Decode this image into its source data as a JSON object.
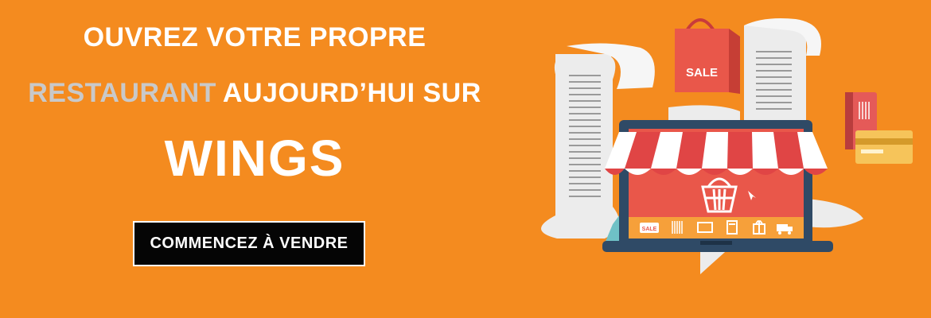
{
  "headline": {
    "line1": "OUVREZ VOTRE PROPRE",
    "line2_highlight": "RESTAURANT",
    "line2_rest": "AUJOURD’HUI SUR",
    "line3": "WINGS"
  },
  "cta": {
    "label": "COMMENCEZ À VENDRE"
  },
  "illustration": {
    "bag_label": "SALE",
    "tag_label": "SALE",
    "icons": [
      "basket-icon",
      "sale-tag-icon",
      "barcode-icon",
      "scanner-icon",
      "calculator-icon",
      "gift-icon",
      "truck-icon",
      "credit-card-icon",
      "shopping-bag-icon"
    ]
  },
  "colors": {
    "background": "#f48b1f",
    "headline_text": "#ffffff",
    "highlight_text": "#c9c9c9",
    "button_bg": "#050505",
    "awning_red": "#e04545",
    "screen_red": "#e9574a",
    "laptop_frame": "#2f4a66"
  }
}
